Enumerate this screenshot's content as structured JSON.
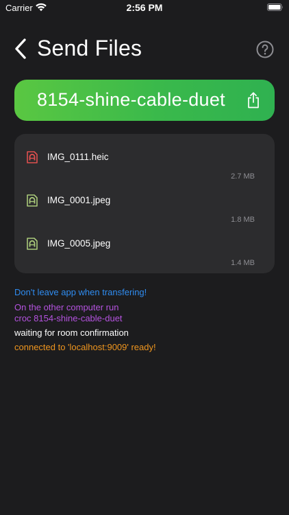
{
  "status_bar": {
    "carrier": "Carrier",
    "time": "2:56 PM"
  },
  "nav": {
    "title": "Send Files",
    "back_icon": "chevron-left-icon",
    "help_icon": "question-circle-icon"
  },
  "code_bar": {
    "code": "8154-shine-cable-duet",
    "share_icon": "share-icon",
    "color_start": "#5ac742",
    "color_end": "#2fb150"
  },
  "files": [
    {
      "name": "IMG_0111.heic",
      "size": "2.7 MB",
      "icon": "file-image-icon",
      "icon_color": "#e0504f"
    },
    {
      "name": "IMG_0001.jpeg",
      "size": "1.8 MB",
      "icon": "file-image-icon",
      "icon_color": "#a9c97a"
    },
    {
      "name": "IMG_0005.jpeg",
      "size": "1.4 MB",
      "icon": "file-image-icon",
      "icon_color": "#a9c97a"
    }
  ],
  "log": {
    "warning": "Don't leave app when transfering!",
    "instruction_line1": "On the other computer run",
    "instruction_line2": "croc 8154-shine-cable-duet",
    "status": "waiting for room confirmation",
    "connection": "connected to 'localhost:9009' ready!",
    "colors": {
      "warning": "#2f8cf0",
      "instruction": "#b553e0",
      "status": "#ffffff",
      "connection": "#f0961e"
    }
  }
}
